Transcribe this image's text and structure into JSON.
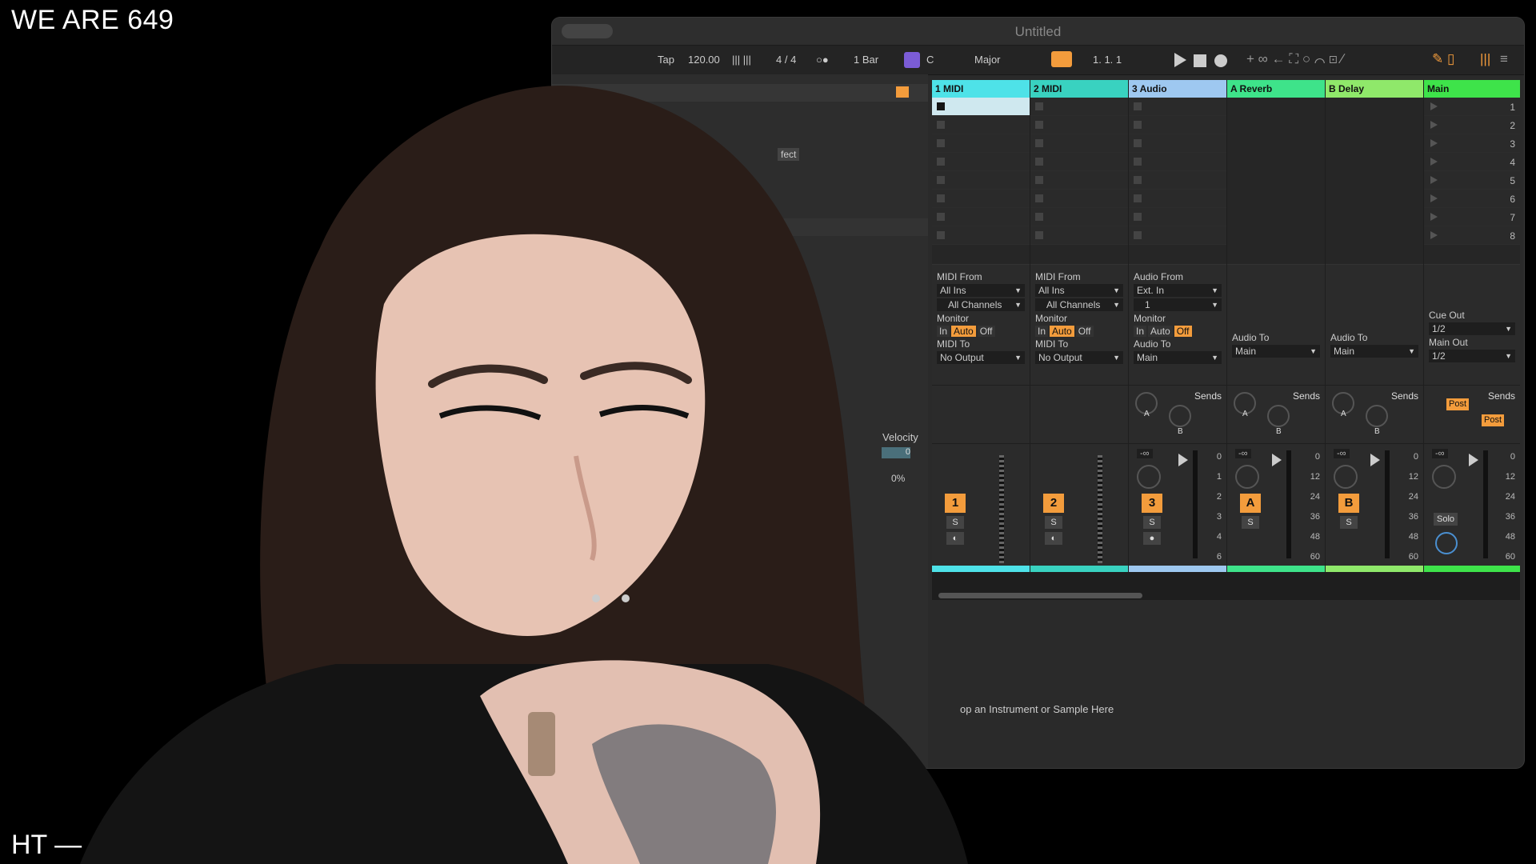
{
  "overlay": {
    "title": "WE ARE 649",
    "footer": "HT —"
  },
  "window": {
    "title": "Untitled"
  },
  "transport": {
    "tap": "Tap",
    "tempo": "120.00",
    "metro_bars": "|||  |||",
    "signature": "4 / 4",
    "record_mode": "○●",
    "quantize": "1 Bar",
    "root_key": "C",
    "scale": "Major",
    "position": "1.  1.  1"
  },
  "left_pane": {
    "fragment": "fect",
    "velocity_label": "Velocity",
    "velocity_value": "0",
    "percent": "0%",
    "drop_hint": "op an Instrument or Sample Here"
  },
  "tracks": [
    {
      "name": "1 MIDI",
      "color": "#4ee2e8",
      "type": "midi",
      "from_label": "MIDI From",
      "from": "All Ins",
      "channel": "All Channels",
      "monitor_label": "Monitor",
      "monitor": [
        "In",
        "Auto",
        "Off"
      ],
      "monitor_active": "Auto",
      "to_label": "MIDI To",
      "to": "No Output",
      "number": "1",
      "solo": "S"
    },
    {
      "name": "2 MIDI",
      "color": "#39d2c0",
      "type": "midi",
      "from_label": "MIDI From",
      "from": "All Ins",
      "channel": "All Channels",
      "monitor_label": "Monitor",
      "monitor": [
        "In",
        "Auto",
        "Off"
      ],
      "monitor_active": "Auto",
      "to_label": "MIDI To",
      "to": "No Output",
      "number": "2",
      "solo": "S"
    },
    {
      "name": "3 Audio",
      "color": "#9ec8f0",
      "type": "audio",
      "from_label": "Audio From",
      "from": "Ext. In",
      "channel": "1",
      "monitor_label": "Monitor",
      "monitor": [
        "In",
        "Auto",
        "Off"
      ],
      "monitor_active": "Off",
      "to_label": "Audio To",
      "to": "Main",
      "number": "3",
      "solo": "S",
      "sends_label": "Sends",
      "send_a": "A",
      "send_b": "B",
      "vol": "-∞"
    },
    {
      "name": "A Reverb",
      "color": "#3ee38a",
      "type": "return",
      "to_label": "Audio To",
      "to": "Main",
      "number": "A",
      "solo": "S",
      "sends_label": "Sends",
      "send_a": "A",
      "send_b": "B",
      "vol": "-∞"
    },
    {
      "name": "B Delay",
      "color": "#8fe86a",
      "type": "return",
      "to_label": "Audio To",
      "to": "Main",
      "number": "B",
      "solo": "S",
      "sends_label": "Sends",
      "send_a": "A",
      "send_b": "B",
      "vol": "-∞"
    },
    {
      "name": "Main",
      "color": "#3ee34a",
      "type": "main",
      "cue_label": "Cue Out",
      "cue": "1/2",
      "main_out_label": "Main Out",
      "main_out": "1/2",
      "sends_label": "Sends",
      "post1": "Post",
      "post2": "Post",
      "solo": "Solo",
      "vol": "-∞"
    }
  ],
  "scenes": [
    "1",
    "2",
    "3",
    "4",
    "5",
    "6",
    "7",
    "8"
  ],
  "meter_scale": [
    "0",
    "12",
    "24",
    "36",
    "48",
    "60"
  ],
  "meter_scale_short": [
    "0",
    "1",
    "2",
    "3",
    "4",
    "6"
  ]
}
